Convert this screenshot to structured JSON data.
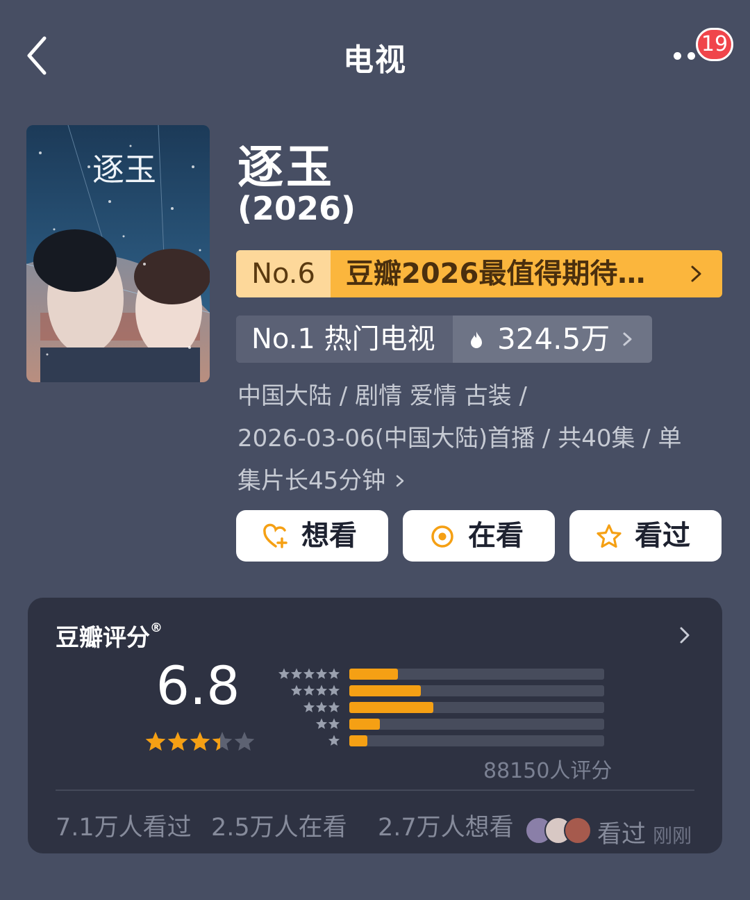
{
  "header": {
    "title": "电视",
    "back_icon": "chevron-left-icon",
    "more_icon": "more-dots-icon",
    "notification_count": "19"
  },
  "poster": {
    "calligraphy": "逐玉",
    "colors": {
      "bg_top": "#21405d",
      "bg_bottom": "#3d4a5e"
    }
  },
  "show": {
    "title": "逐玉",
    "year": "(2026)"
  },
  "rankings": {
    "primary": {
      "number": "No.6",
      "label": "豆瓣2026最值得期待…"
    },
    "secondary": {
      "label": "No.1 热门电视",
      "heat": "324.5万"
    }
  },
  "meta": {
    "line1": "中国大陆 / 剧情 爱情 古装 /",
    "line2": "2026-03-06(中国大陆)首播 / 共40集 / 单",
    "line3": "集片长45分钟"
  },
  "actions": {
    "want": "想看",
    "doing": "在看",
    "done": "看过"
  },
  "rating": {
    "title": "豆瓣评分",
    "mark": "®",
    "score": "6.8",
    "stars": 3.4,
    "distribution": [
      {
        "stars": 5,
        "fraction": 0.19
      },
      {
        "stars": 4,
        "fraction": 0.28
      },
      {
        "stars": 3,
        "fraction": 0.33
      },
      {
        "stars": 2,
        "fraction": 0.12
      },
      {
        "stars": 1,
        "fraction": 0.07
      }
    ],
    "raters": "88150人评分",
    "stats": {
      "watched": "7.1万人看过",
      "watching": "2.5万人在看",
      "want": "2.7万人想看"
    },
    "recent": {
      "action": "看过",
      "time": "刚刚"
    }
  },
  "colors": {
    "background": "#474e63",
    "accent": "#f5a014",
    "rank_bg": "#fbb63d",
    "badge": "#f0454b",
    "card": "#2e3242"
  }
}
